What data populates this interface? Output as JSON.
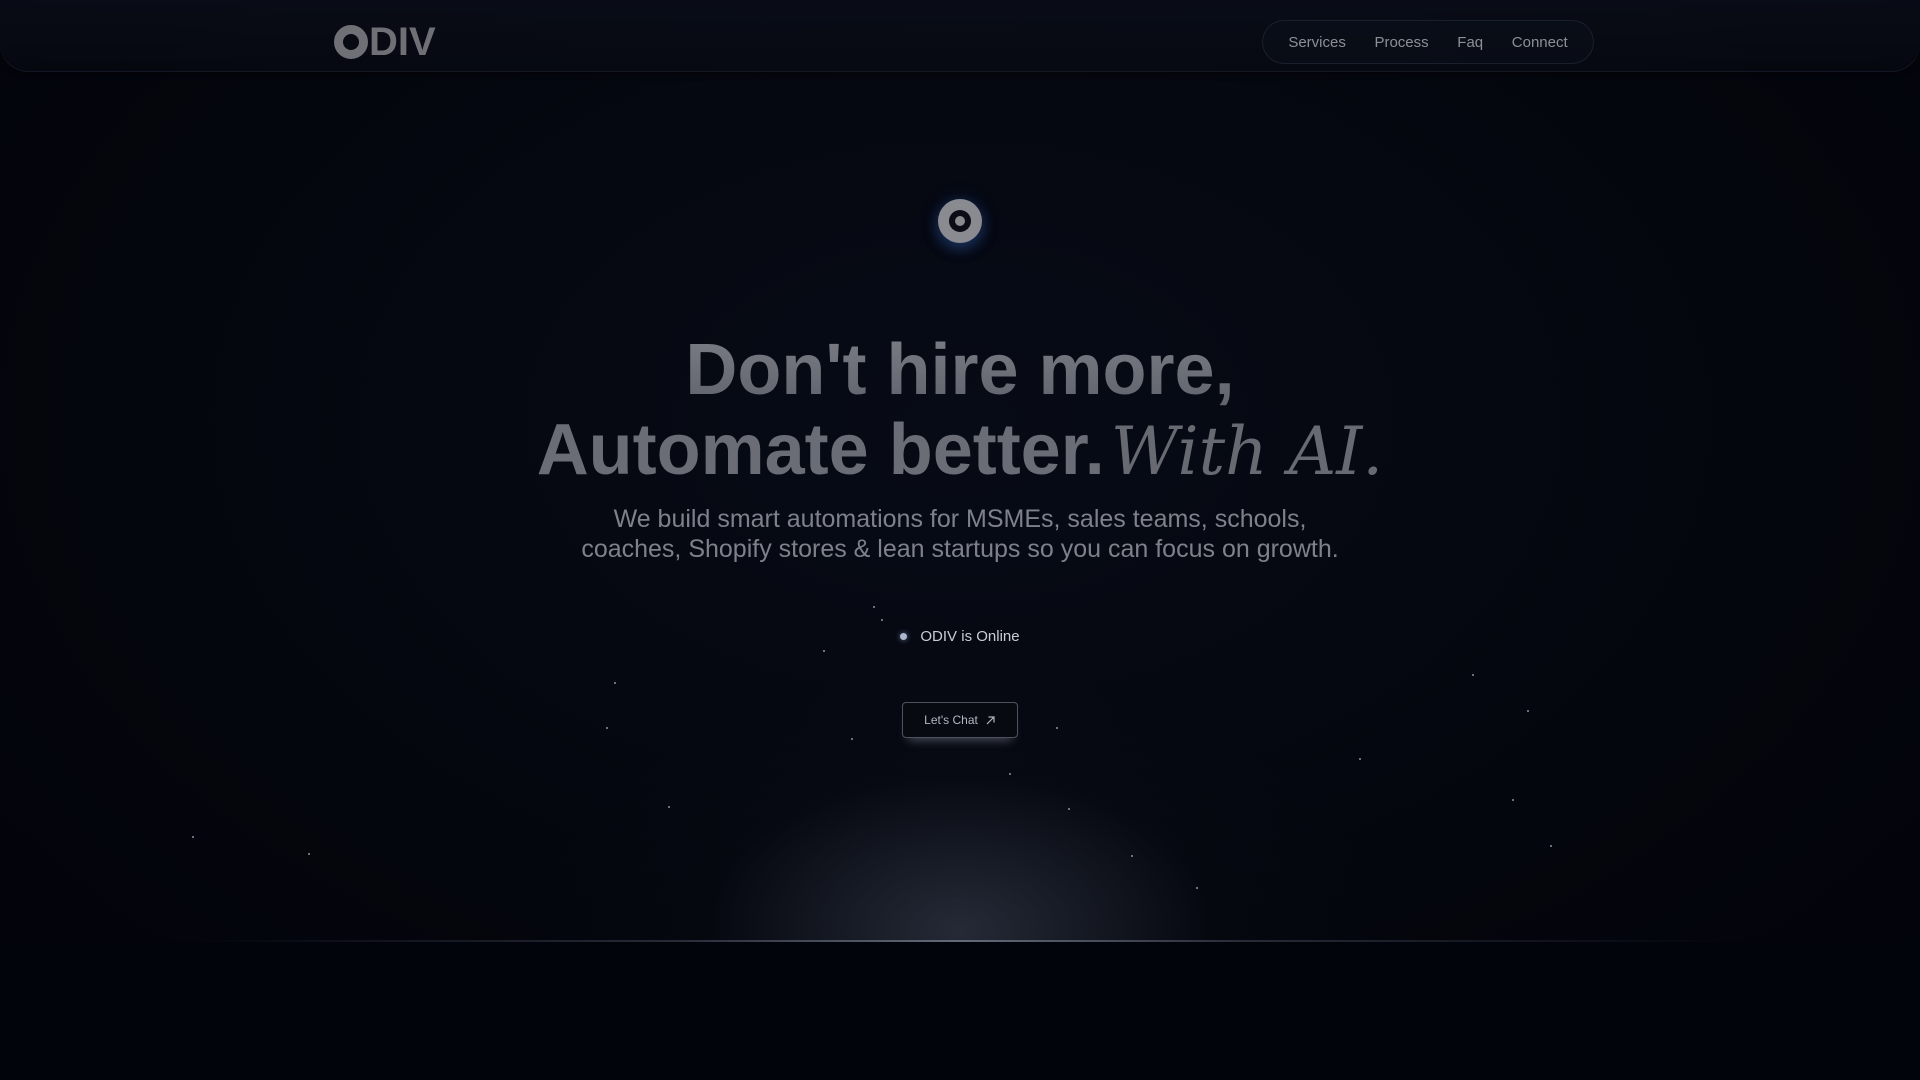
{
  "brand": {
    "logo_text": "DIV",
    "logo_full": "ODIV"
  },
  "nav": {
    "items": [
      {
        "label": "Services"
      },
      {
        "label": "Process"
      },
      {
        "label": "Faq"
      },
      {
        "label": "Connect"
      }
    ]
  },
  "hero": {
    "headline_line1": "Don't hire more,",
    "headline_line2": "Automate better.",
    "headline_accent": "With AI.",
    "subtitle_line1": "We build smart automations for MSMEs, sales teams, schools,",
    "subtitle_line2": "coaches, Shopify stores & lean startups so you can focus on growth.",
    "status_text": "ODIV is Online",
    "cta_label": "Let's Chat",
    "cta_icon": "arrow-up-right-icon"
  },
  "colors": {
    "background": "#03050c",
    "text_muted": "#7e818b",
    "status_dot": "#aeb6cf",
    "icon_glow": "#3c6ec8"
  }
}
